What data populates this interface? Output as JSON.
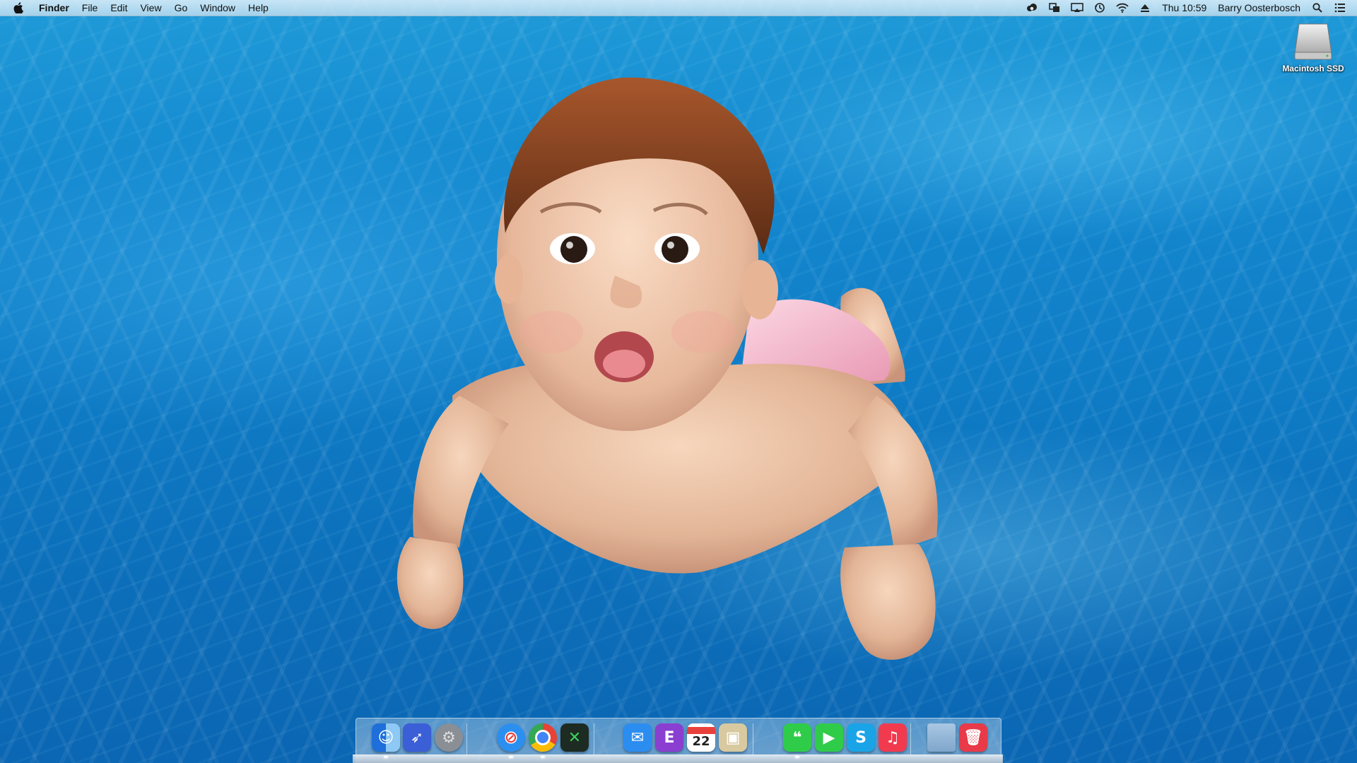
{
  "menubar": {
    "apple_icon": "apple-logo-icon",
    "app_name": "Finder",
    "menus": [
      "File",
      "Edit",
      "View",
      "Go",
      "Window",
      "Help"
    ],
    "status_icons": [
      "creative-cloud-icon",
      "screen-mirror-icon",
      "airplay-icon",
      "time-machine-icon",
      "wifi-icon",
      "eject-icon"
    ],
    "clock": "Thu 10:59",
    "user": "Barry Oosterbosch",
    "spotlight_icon": "spotlight-search-icon",
    "notification_icon": "notification-center-icon"
  },
  "desktop": {
    "disk_label": "Macintosh SSD",
    "disk_icon": "hard-drive-icon"
  },
  "dock": {
    "items": [
      {
        "name": "finder",
        "icon": "finder-icon",
        "color": "#3a8ee8",
        "running": true
      },
      {
        "name": "launchpad",
        "icon": "rocket-icon",
        "color": "#3b5fd6",
        "running": false
      },
      {
        "name": "system-preferences",
        "icon": "gear-icon",
        "color": "#8a8f96",
        "running": false
      },
      {
        "name": "safari",
        "icon": "compass-icon",
        "color": "#2b8ff0",
        "running": true
      },
      {
        "name": "chrome",
        "icon": "chrome-icon",
        "color": "#e94235",
        "running": true
      },
      {
        "name": "xmind",
        "icon": "xmind-icon",
        "color": "#1d2b22",
        "running": false
      },
      {
        "name": "mail",
        "icon": "envelope-icon",
        "color": "#2c8df0",
        "running": false
      },
      {
        "name": "evernote",
        "icon": "evernote-icon",
        "color": "#8a3fd1",
        "running": false
      },
      {
        "name": "calendar",
        "icon": "calendar-icon",
        "color": "#ffffff",
        "running": false,
        "day": "22"
      },
      {
        "name": "preview",
        "icon": "preview-icon",
        "color": "#d8c9a0",
        "running": false
      },
      {
        "name": "messages",
        "icon": "speech-bubble-icon",
        "color": "#2fcc4a",
        "running": true
      },
      {
        "name": "facetime",
        "icon": "video-camera-icon",
        "color": "#2fcc4a",
        "running": false
      },
      {
        "name": "skype",
        "icon": "skype-icon",
        "color": "#1aa4e8",
        "running": false
      },
      {
        "name": "itunes",
        "icon": "music-note-icon",
        "color": "#f23a4f",
        "running": false
      },
      {
        "name": "downloads",
        "icon": "folder-icon",
        "color": "#8fb4d8",
        "running": false
      },
      {
        "name": "trash",
        "icon": "trash-icon",
        "color": "#e83a48",
        "running": false
      }
    ]
  }
}
